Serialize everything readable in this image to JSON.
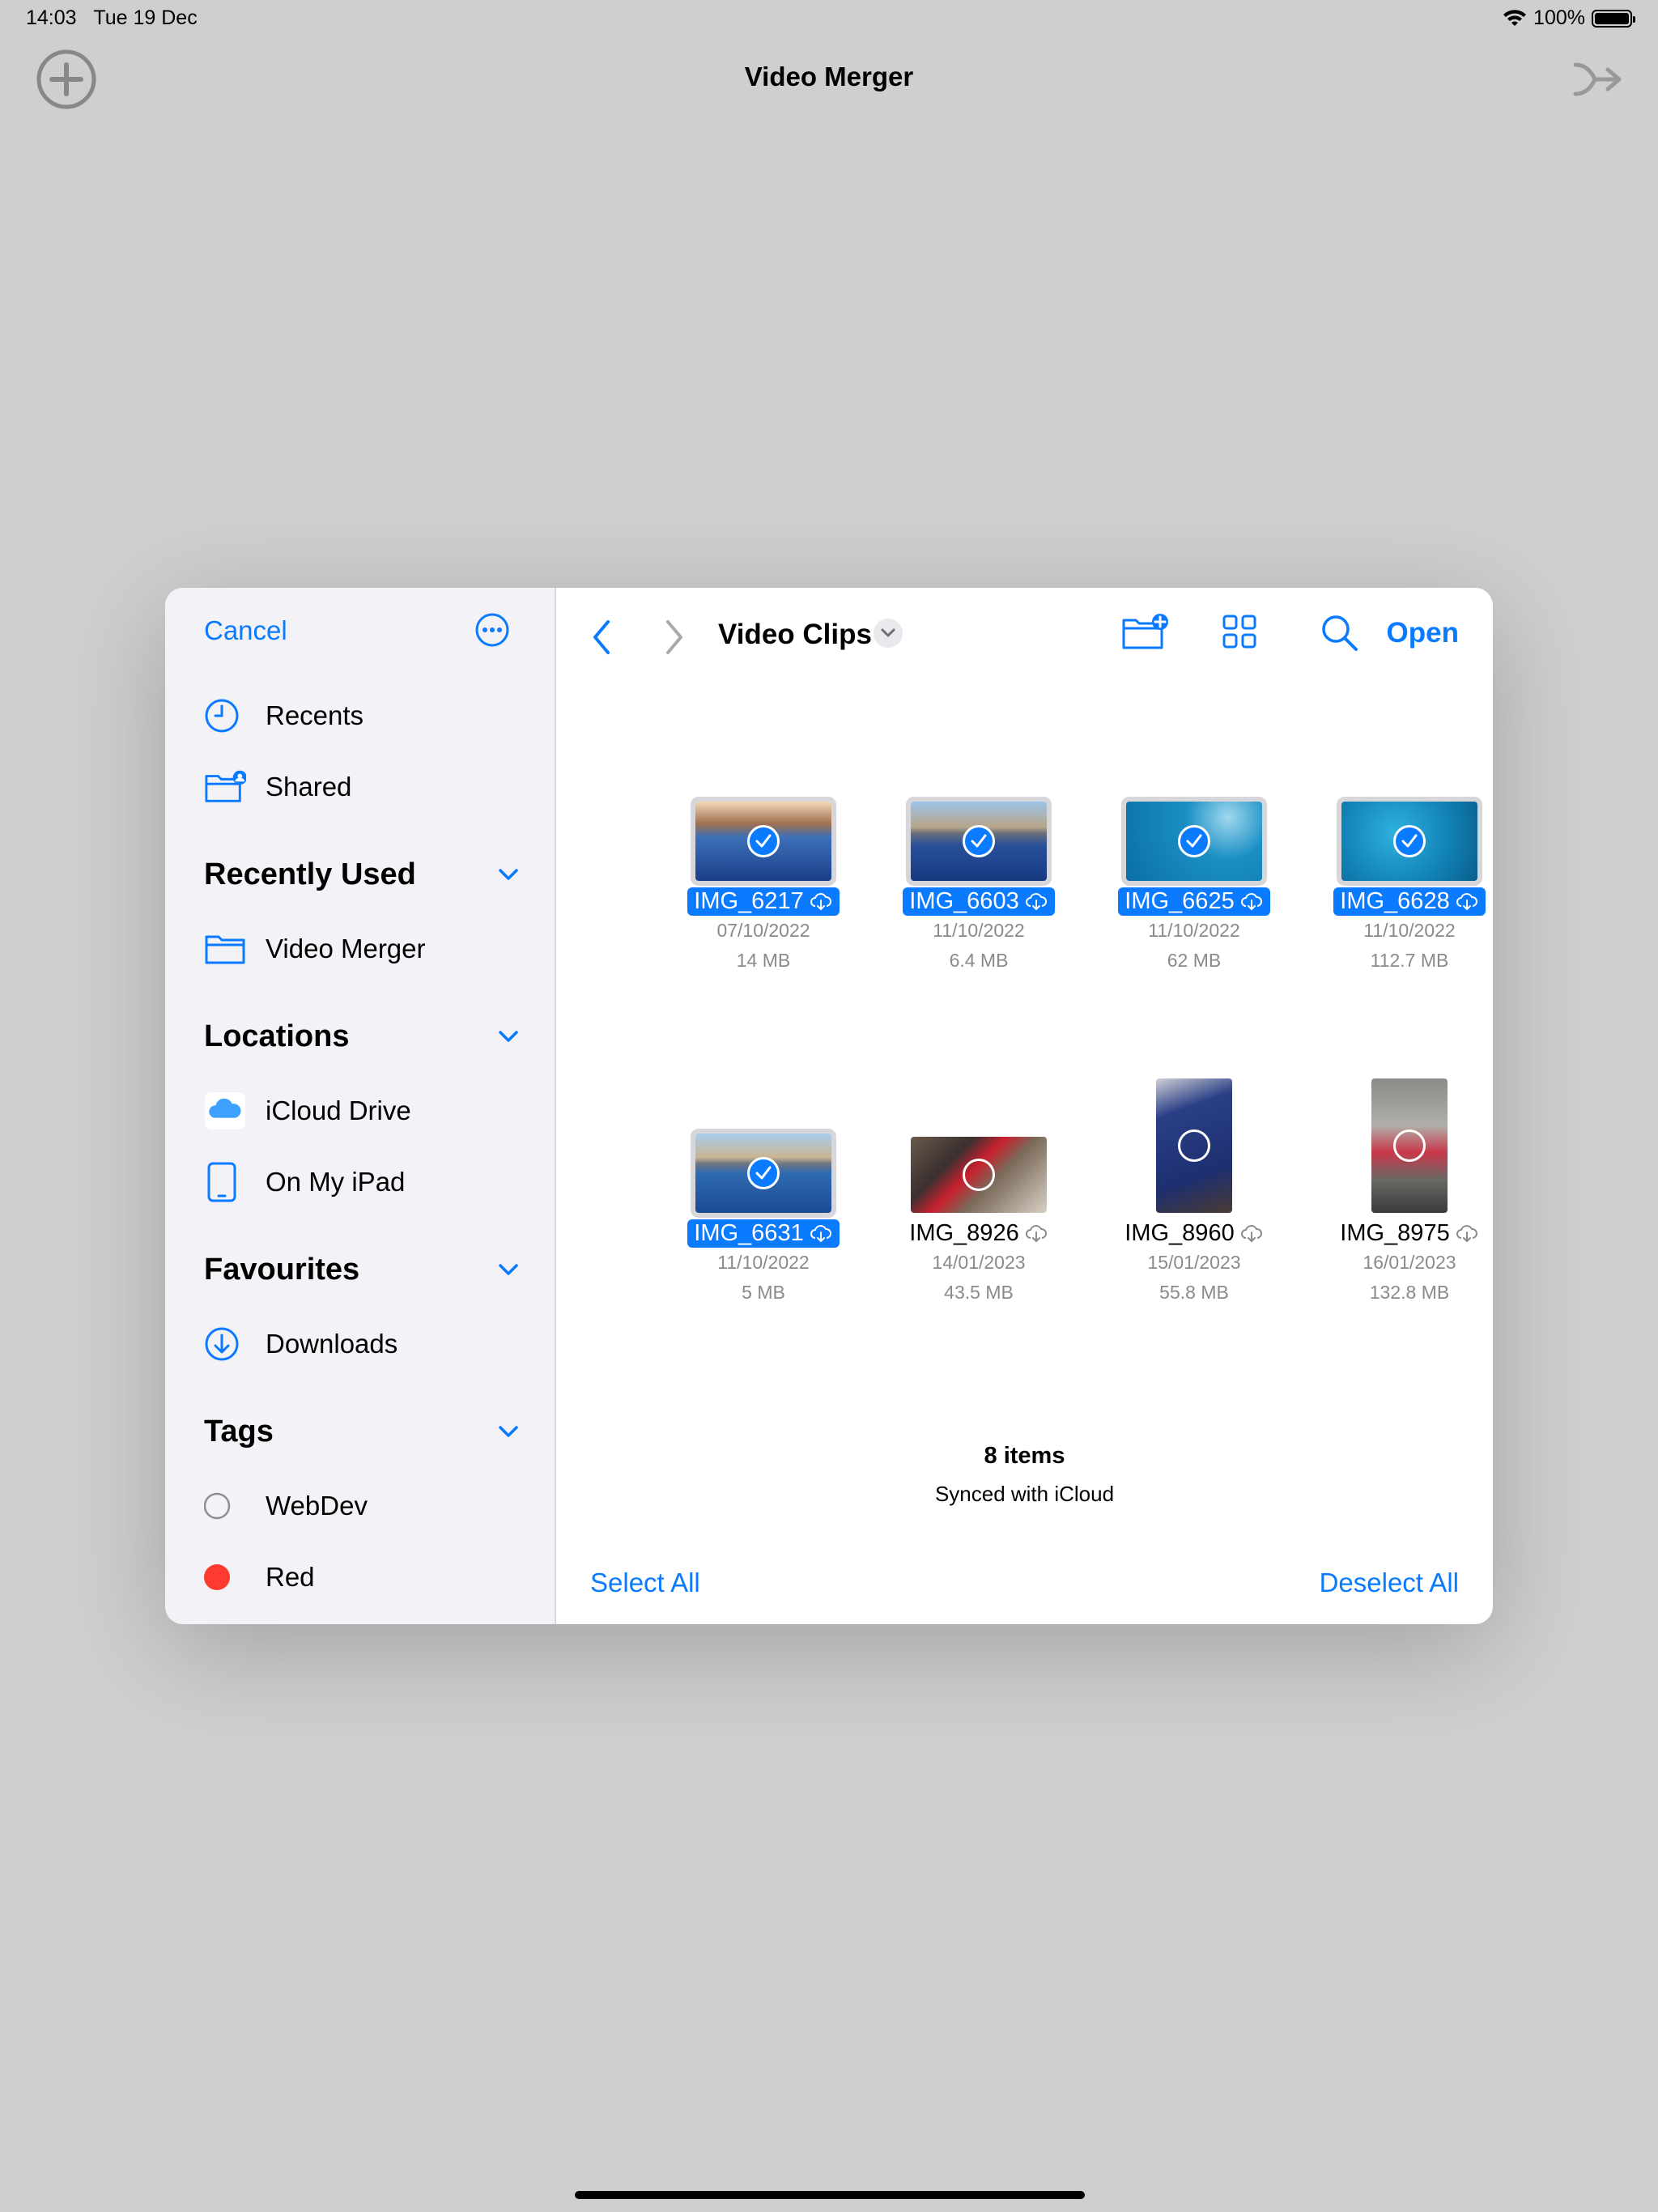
{
  "status": {
    "time": "14:03",
    "date": "Tue 19 Dec",
    "battery": "100%"
  },
  "app": {
    "title": "Video Merger"
  },
  "picker": {
    "cancel": "Cancel",
    "sidebar": {
      "recents": "Recents",
      "shared": "Shared",
      "recently_used": {
        "title": "Recently Used",
        "items": [
          "Video Merger"
        ]
      },
      "locations": {
        "title": "Locations",
        "items": [
          "iCloud Drive",
          "On My iPad"
        ]
      },
      "favourites": {
        "title": "Favourites",
        "items": [
          "Downloads"
        ]
      },
      "tags": {
        "title": "Tags",
        "items": [
          {
            "label": "WebDev",
            "color": "none"
          },
          {
            "label": "Red",
            "color": "#ff3b30"
          }
        ]
      }
    },
    "folder_title": "Video Clips",
    "open": "Open",
    "files": [
      {
        "name": "IMG_6217",
        "date": "07/10/2022",
        "size": "14 MB",
        "selected": true
      },
      {
        "name": "IMG_6603",
        "date": "11/10/2022",
        "size": "6.4 MB",
        "selected": true
      },
      {
        "name": "IMG_6625",
        "date": "11/10/2022",
        "size": "62 MB",
        "selected": true
      },
      {
        "name": "IMG_6628",
        "date": "11/10/2022",
        "size": "112.7 MB",
        "selected": true
      },
      {
        "name": "IMG_6631",
        "date": "11/10/2022",
        "size": "5 MB",
        "selected": true
      },
      {
        "name": "IMG_8926",
        "date": "14/01/2023",
        "size": "43.5 MB",
        "selected": false
      },
      {
        "name": "IMG_8960",
        "date": "15/01/2023",
        "size": "55.8 MB",
        "selected": false
      },
      {
        "name": "IMG_8975",
        "date": "16/01/2023",
        "size": "132.8 MB",
        "selected": false
      }
    ],
    "footer": {
      "count": "8 items",
      "sync": "Synced with iCloud",
      "select_all": "Select All",
      "deselect_all": "Deselect All"
    }
  },
  "colors": {
    "accent": "#0a7aff",
    "backdrop": "#cfcfcf",
    "tag_red": "#ff3b30"
  }
}
